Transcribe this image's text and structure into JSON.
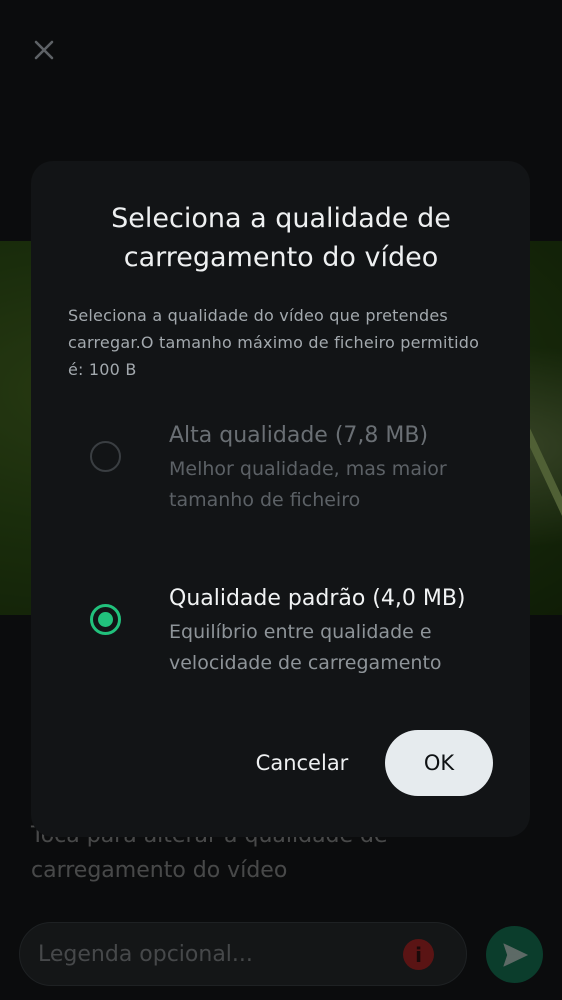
{
  "editor": {
    "close_icon": "close-icon",
    "hint_text": "Toca para alterar a qualidade de carregamento do vídeo",
    "caption_placeholder": "Legenda opcional...",
    "info_icon": "info-icon",
    "info_glyph": "i",
    "send_icon": "send-icon"
  },
  "dialog": {
    "title": "Seleciona a qualidade de carregamento do vídeo",
    "description": "Seleciona a qualidade do vídeo que pretendes carregar.O tamanho máximo de ficheiro permitido é: 100 B",
    "options": [
      {
        "label": "Alta qualidade (7,8 MB)",
        "sublabel": "Melhor qualidade, mas maior tamanho de ficheiro",
        "selected": false
      },
      {
        "label": "Qualidade padrão (4,0 MB)",
        "sublabel": "Equilíbrio entre qualidade e velocidade de carregamento",
        "selected": true
      }
    ],
    "cancel_label": "Cancelar",
    "ok_label": "OK"
  },
  "colors": {
    "accent": "#21c17c",
    "dialog_bg": "#121416",
    "ok_button_bg": "#e6ebee",
    "send_button_bg": "#0b3d2c"
  }
}
